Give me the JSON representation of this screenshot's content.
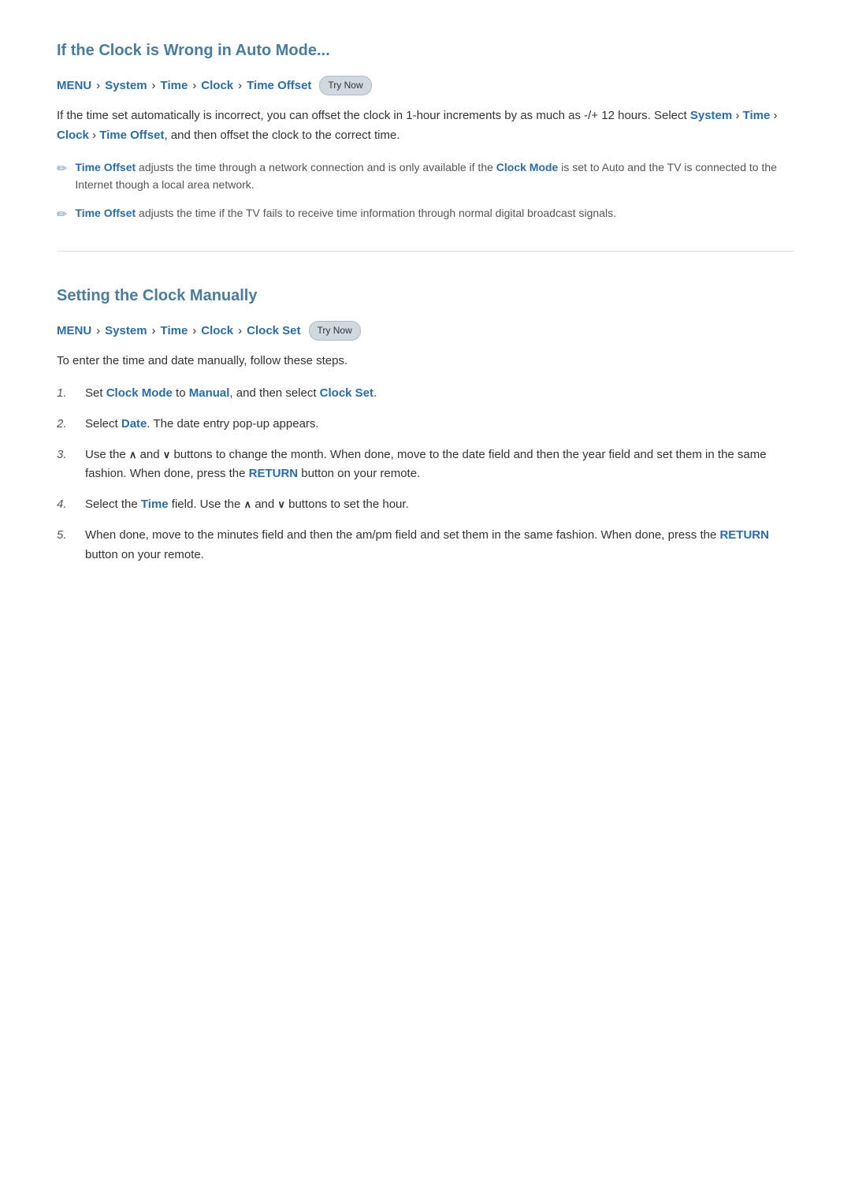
{
  "section1": {
    "title": "If the Clock is Wrong in Auto Mode...",
    "breadcrumb": {
      "items": [
        "MENU",
        "System",
        "Time",
        "Clock",
        "Time Offset"
      ],
      "badge": "Try Now"
    },
    "body": "If the time set automatically is incorrect, you can offset the clock in 1-hour increments by as much as -/+ 12 hours. Select System > Time > Clock > Time Offset, and then offset the clock to the correct time.",
    "notes": [
      {
        "text_before": "",
        "highlight1": "Time Offset",
        "text_mid": " adjusts the time through a network connection and is only available if the ",
        "highlight2": "Clock Mode",
        "text_after": " is set to Auto and the TV is connected to the Internet though a local area network."
      },
      {
        "text_before": "",
        "highlight1": "Time Offset",
        "text_mid": " adjusts the time if the TV fails to receive time information through normal digital broadcast signals.",
        "highlight2": "",
        "text_after": ""
      }
    ]
  },
  "section2": {
    "title": "Setting the Clock Manually",
    "breadcrumb": {
      "items": [
        "MENU",
        "System",
        "Time",
        "Clock",
        "Clock Set"
      ],
      "badge": "Try Now"
    },
    "intro": "To enter the time and date manually, follow these steps.",
    "steps": [
      {
        "num": "1.",
        "text": "Set Clock Mode to Manual, and then select Clock Set."
      },
      {
        "num": "2.",
        "text": "Select Date. The date entry pop-up appears."
      },
      {
        "num": "3.",
        "text": "Use the ∧ and ∨ buttons to change the month. When done, move to the date field and then the year field and set them in the same fashion. When done, press the RETURN button on your remote."
      },
      {
        "num": "4.",
        "text": "Select the Time field. Use the ∧ and ∨ buttons to set the hour."
      },
      {
        "num": "5.",
        "text": "When done, move to the minutes field and then the am/pm field and set them in the same fashion. When done, press the RETURN button on your remote."
      }
    ]
  },
  "colors": {
    "blue": "#2a6da8",
    "teal_title": "#4a7c9e",
    "badge_bg": "#d0d8e0"
  }
}
